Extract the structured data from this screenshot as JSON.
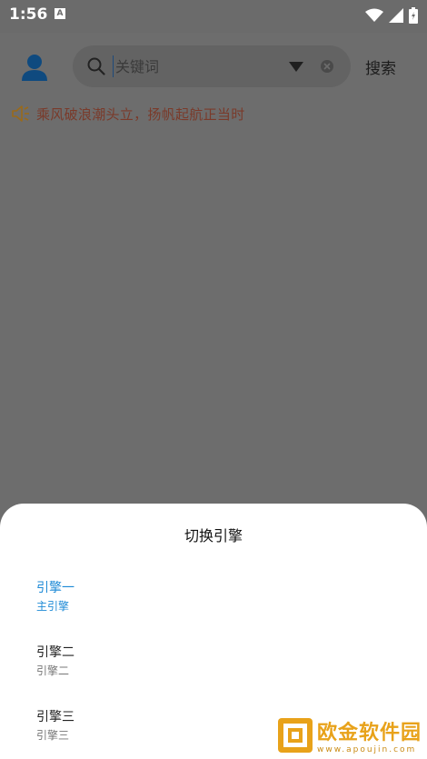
{
  "status_bar": {
    "time": "1:56",
    "notification_letter": "A"
  },
  "header": {
    "search_placeholder": "关键词",
    "search_button_label": "搜索"
  },
  "notice": {
    "text": "乘风破浪潮头立，扬帆起航正当时"
  },
  "engine_sheet": {
    "title": "切换引擎",
    "engines": [
      {
        "name": "引擎一",
        "desc": "主引擎",
        "selected": true
      },
      {
        "name": "引擎二",
        "desc": "引擎二",
        "selected": false
      },
      {
        "name": "引擎三",
        "desc": "引擎三",
        "selected": false
      }
    ]
  },
  "watermark": {
    "text": "欧金软件园",
    "url": "www.apoujin.com"
  },
  "colors": {
    "overlay_bg": "#6d6d6d",
    "accent_blue": "#1e8ad6",
    "notice_color": "#7a3a2a",
    "watermark_gold": "#e8a21a"
  },
  "icons": [
    "avatar-icon",
    "search-icon",
    "chevron-down-icon",
    "clear-icon",
    "speaker-icon",
    "wifi-icon",
    "signal-icon",
    "battery-icon"
  ]
}
